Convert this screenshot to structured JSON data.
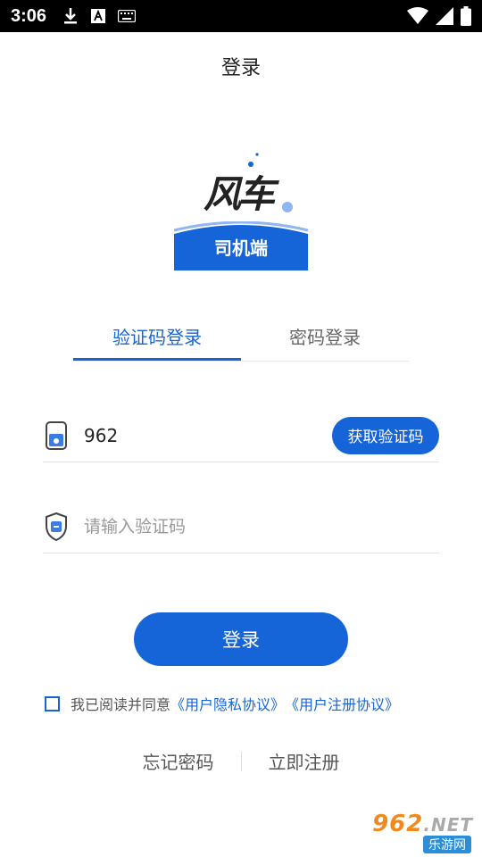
{
  "status_bar": {
    "time": "3:06",
    "left_icons": [
      "download-icon",
      "a-badge-icon",
      "keyboard-icon"
    ],
    "right_icons": [
      "wifi-icon",
      "signal-icon",
      "battery-icon"
    ]
  },
  "header": {
    "title": "登录"
  },
  "logo": {
    "wordmark": "风车",
    "label": "司机端"
  },
  "tabs": [
    {
      "label": "验证码登录",
      "active": true
    },
    {
      "label": "密码登录",
      "active": false
    }
  ],
  "phone_field": {
    "value": "962",
    "icon": "phone-icon",
    "button_label": "获取验证码"
  },
  "code_field": {
    "placeholder": "请输入验证码",
    "icon": "shield-verify-icon"
  },
  "login_button": {
    "label": "登录"
  },
  "agreement": {
    "checked": false,
    "text": "我已阅读并同意",
    "privacy_link": "《用户隐私协议》",
    "register_link": "《用户注册协议》"
  },
  "bottom_links": {
    "forgot": "忘记密码",
    "register": "立即注册"
  },
  "watermark": {
    "main": "962",
    "suffix": ".NET",
    "sub": "乐游网"
  },
  "colors": {
    "accent": "#1565d8"
  }
}
